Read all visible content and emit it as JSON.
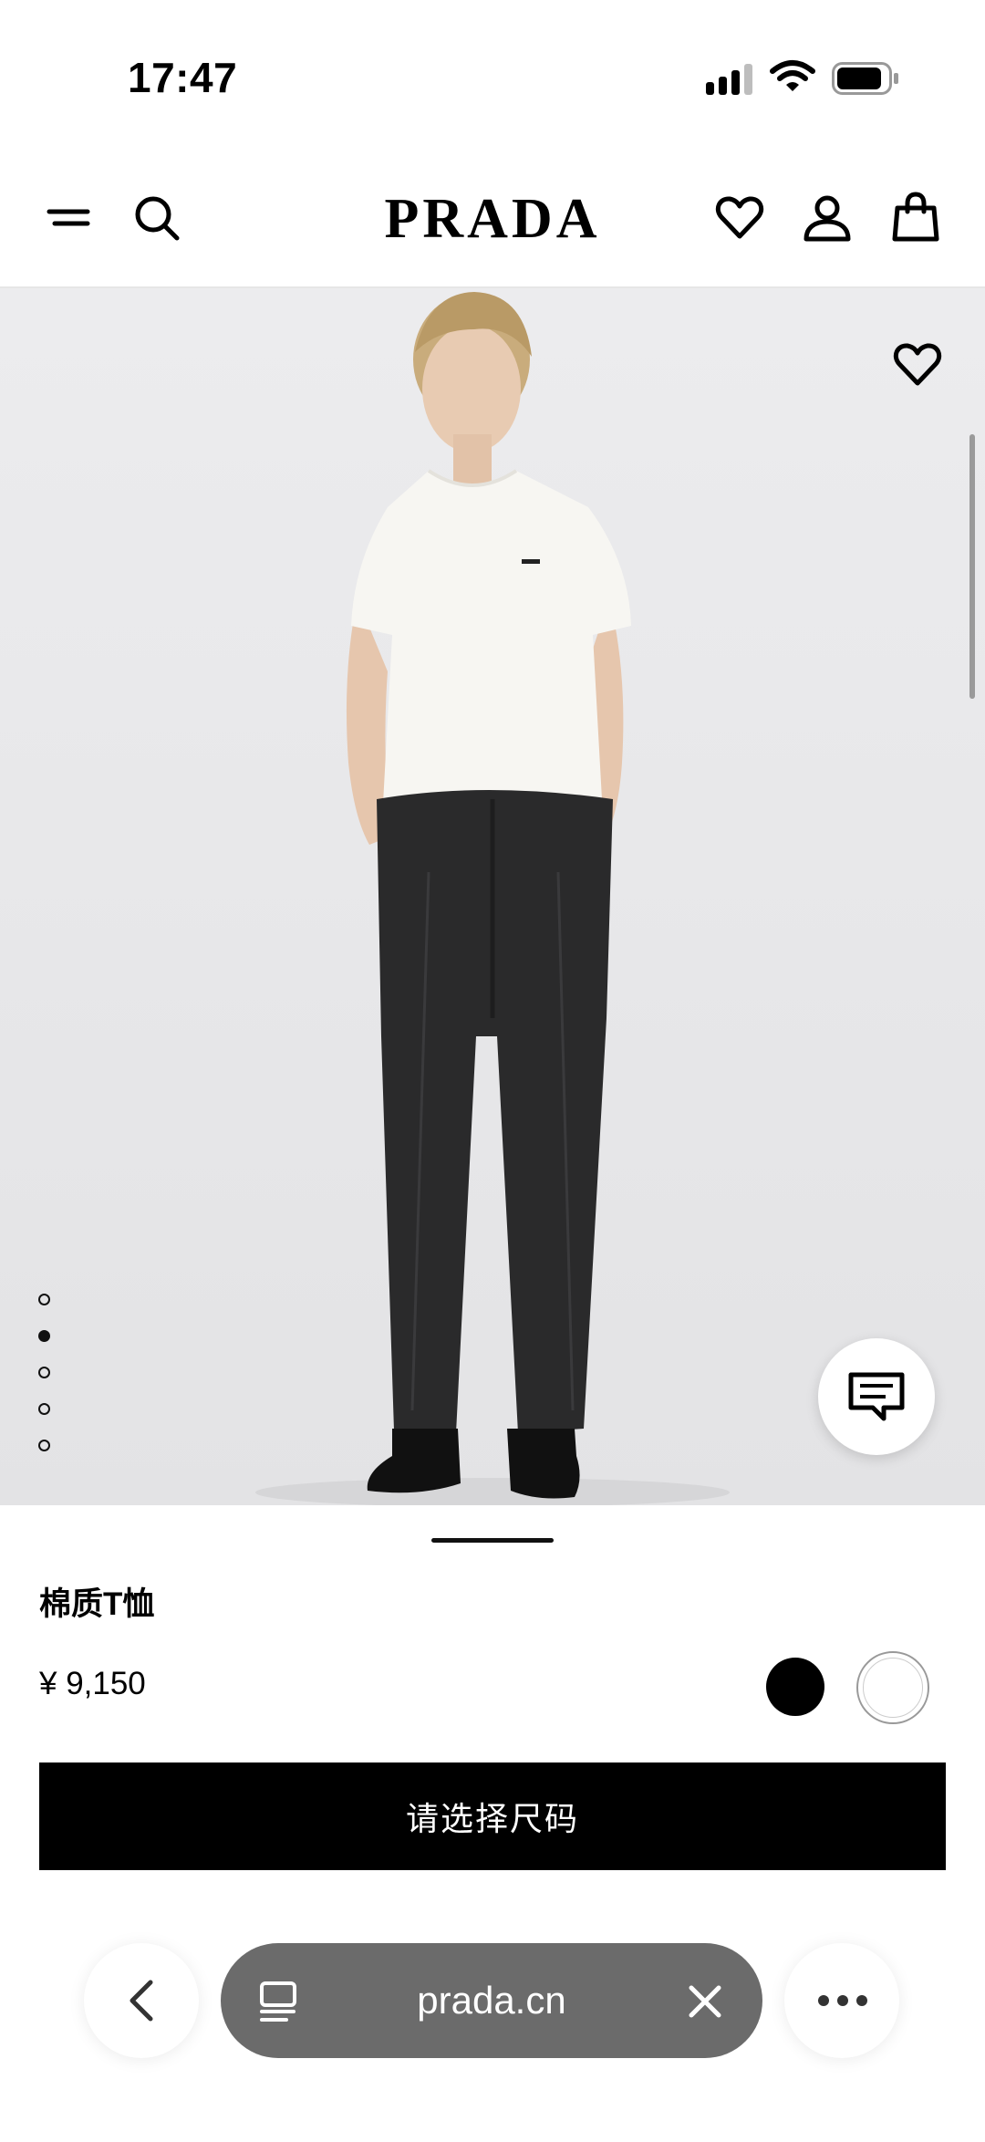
{
  "status_bar": {
    "time": "17:47"
  },
  "header": {
    "brand": "PRADA"
  },
  "product": {
    "name": "棉质T恤",
    "price": "¥ 9,150",
    "colors": [
      "#000000",
      "#ffffff"
    ],
    "image_count": 5,
    "active_image_index": 2,
    "select_size_label": "请选择尺码"
  },
  "browser": {
    "url": "prada.cn"
  },
  "icons": [
    "menu-icon",
    "search-icon",
    "heart-icon",
    "account-icon",
    "bag-icon",
    "chat-icon",
    "back-icon",
    "tabs-icon",
    "close-icon",
    "more-icon"
  ]
}
